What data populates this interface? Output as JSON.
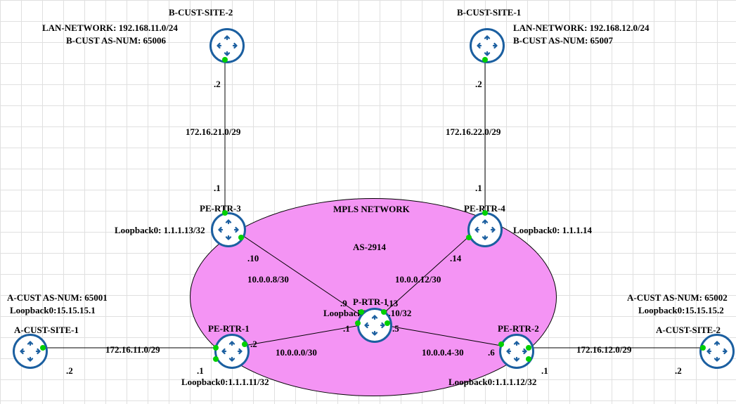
{
  "cloud": {
    "title": "MPLS NETWORK",
    "as": "AS-2914"
  },
  "routers": {
    "p_rtr_1": {
      "name": "P-RTR-1",
      "loopback": "Loopback0:1.1.1.10/32"
    },
    "pe_rtr_1": {
      "name": "PE-RTR-1",
      "loopback": "Loopback0:1.1.1.11/32"
    },
    "pe_rtr_2": {
      "name": "PE-RTR-2",
      "loopback": "Loopback0:1.1.1.12/32"
    },
    "pe_rtr_3": {
      "name": "PE-RTR-3",
      "loopback": "Loopback0: 1.1.1.13/32"
    },
    "pe_rtr_4": {
      "name": "PE-RTR-4",
      "loopback": "Loopback0: 1.1.1.14"
    },
    "a_site_1": {
      "name": "A-CUST-SITE-1",
      "asnum": "A-CUST AS-NUM: 65001",
      "loopback": "Loopback0:15.15.15.1"
    },
    "a_site_2": {
      "name": "A-CUST-SITE-2",
      "asnum": "A-CUST AS-NUM: 65002",
      "loopback": "Loopback0:15.15.15.2"
    },
    "b_site_1": {
      "name": "B-CUST-SITE-1",
      "lan": "LAN-NETWORK: 192.168.12.0/24",
      "asnum": "B-CUST AS-NUM: 65007"
    },
    "b_site_2": {
      "name": "B-CUST-SITE-2",
      "lan": "LAN-NETWORK: 192.168.11.0/24",
      "asnum": "B-CUST AS-NUM: 65006"
    }
  },
  "links": {
    "p_pe1": {
      "subnet": "10.0.0.0/30",
      "ip_p": ".1",
      "ip_pe": ".2"
    },
    "p_pe2": {
      "subnet": "10.0.0.4-30",
      "ip_p": ".5",
      "ip_pe": ".6"
    },
    "p_pe3": {
      "subnet": "10.0.0.8/30",
      "ip_p": ".9",
      "ip_pe": ".10"
    },
    "p_pe4": {
      "subnet": "10.0.0.12/30",
      "ip_p": ".13",
      "ip_pe": ".14"
    },
    "pe1_a1": {
      "subnet": "172.16.11.0/29",
      "ip_pe": ".1",
      "ip_cust": ".2"
    },
    "pe2_a2": {
      "subnet": "172.16.12.0/29",
      "ip_pe": ".1",
      "ip_cust": ".2"
    },
    "pe3_b2": {
      "subnet": "172.16.21.0/29",
      "ip_pe": ".1",
      "ip_cust": ".2"
    },
    "pe4_b1": {
      "subnet": "172.16.22.0/29",
      "ip_pe": ".1",
      "ip_cust": ".2"
    }
  }
}
